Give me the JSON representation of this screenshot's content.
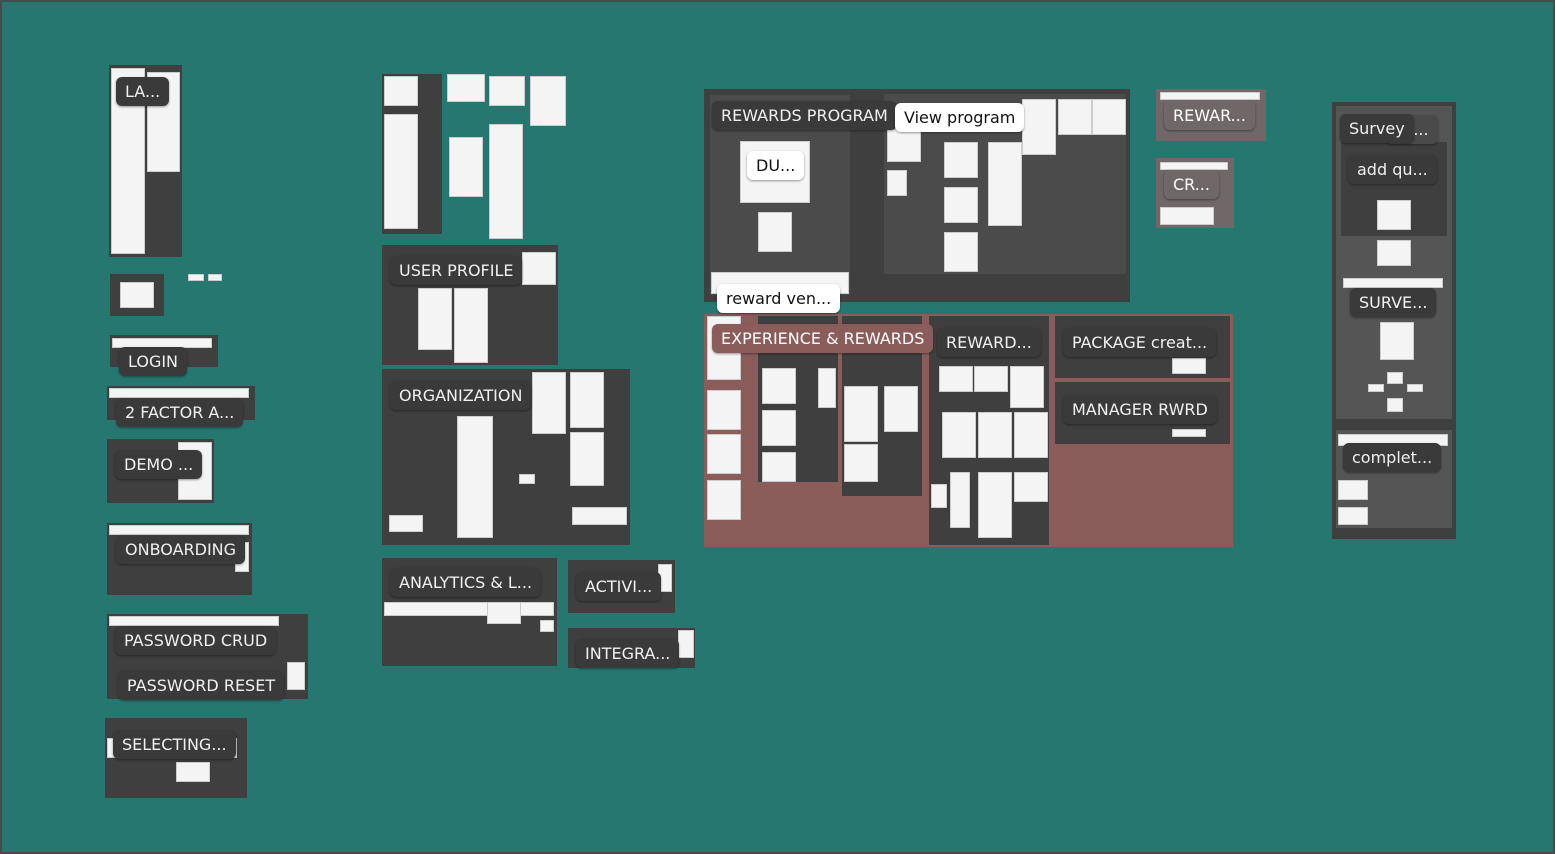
{
  "canvas": {
    "background": "#277771"
  },
  "sections": {
    "landing": "LA...",
    "login": "LOGIN",
    "two_factor": "2 FACTOR A...",
    "demo": "DEMO ...",
    "onboarding": "ONBOARDING",
    "password_crud": "PASSWORD CRUD",
    "password_reset": "PASSWORD RESET",
    "selecting": "SELECTING...",
    "user_profile": "USER PROFILE",
    "organization": "ORGANIZATION",
    "analytics": "ANALYTICS & L...",
    "activity": "ACTIVI...",
    "integrations": "INTEGRA...",
    "rewards_program": "REWARDS PROGRAM",
    "view_program": "View program",
    "du": "DU...",
    "reward_vendor": "reward ven...",
    "rewar": "REWAR...",
    "cr": "CR...",
    "experience_rewards": "EXPERIENCE & REWARDS",
    "reward": "REWARD...",
    "package_create": "PACKAGE creat...",
    "manager_rwrd": "MANAGER RWRD",
    "survey_s": "s...",
    "survey": "Survey",
    "add_question": "add qu...",
    "surve": "SURVE...",
    "complete": "complet..."
  },
  "colors": {
    "section_dark": "#3f3f3f",
    "section_pink": "#8a5d5b",
    "label": "#3a3a3a"
  }
}
